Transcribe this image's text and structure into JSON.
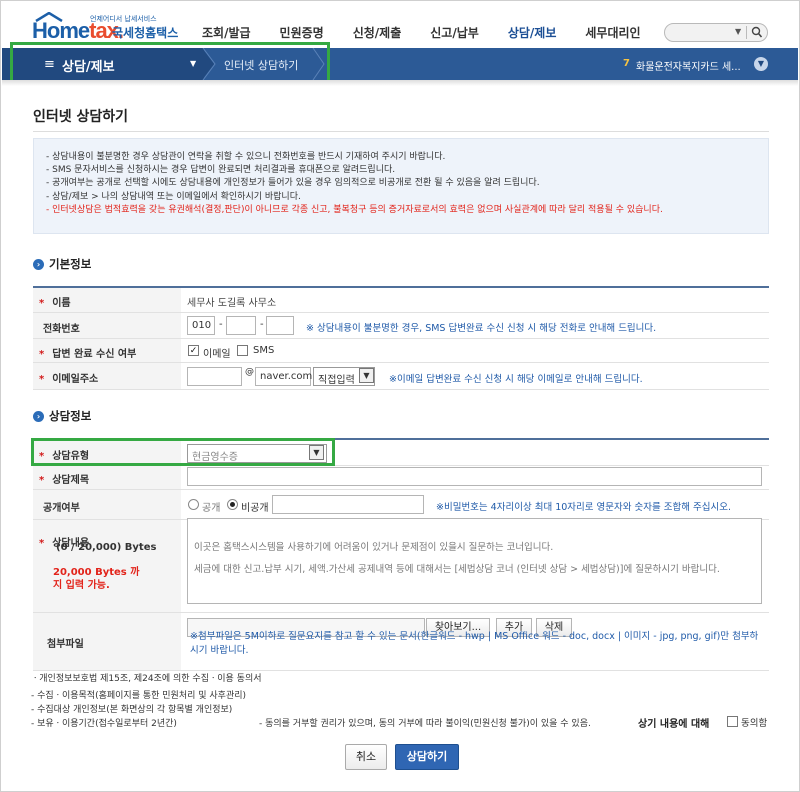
{
  "header": {
    "logo_text_home": "Home",
    "logo_text_tax": "tax.",
    "logo_tagline": "언제어디서 납세서비스",
    "logo_sub": "국세청홈택스",
    "menu": [
      "조회/발급",
      "민원증명",
      "신청/제출",
      "신고/납부",
      "상담/제보",
      "세무대리인"
    ],
    "active_menu": "상담/제보"
  },
  "navbar": {
    "crumb1": "상담/제보",
    "crumb2": "인터넷 상담하기",
    "notice_number": "7",
    "notice_text": "화물운전자복지카드 세..."
  },
  "page": {
    "title": "인터넷 상담하기",
    "info_lines": [
      "상담내용이 불분명한 경우 상담관이 연락을 취할 수 있으니 전화번호를 반드시 기재하여 주시기 바랍니다.",
      "SMS 문자서비스를 신청하시는 경우 답변이 완료되면 처리결과를 휴대폰으로 알려드립니다.",
      "공개여부는 공개로 선택할 시에도 상담내용에 개인정보가 들어가 있을 경우 임의적으로 비공개로 전환 될 수 있음을 알려 드립니다.",
      "상담/제보 > 나의 상담내역 또는 이메일에서 확인하시기 바랍니다.",
      "인터넷상담은 법적효력을 갖는 유권해석(결정,판단)이 아니므로 각종 신고, 불복청구 등의 증거자료로서의 효력은 없으며 사실관계에 따라 달리 적용될 수 있습니다."
    ]
  },
  "basic_info": {
    "section_title": "기본정보",
    "name_label": "이름",
    "name_value": "세무사 도길록 사무소",
    "phone_label": "전화번호",
    "phone_prefix": "010",
    "phone_dash": "-",
    "phone_hint": "※ 상담내용이 불분명한 경우, SMS 답변완료 수신 신청 시 해당 전화로 안내해 드립니다.",
    "reply_label": "답변 완료 수신 여부",
    "reply_email": "이메일",
    "reply_sms": "SMS",
    "email_label": "이메일주소",
    "email_at": "@",
    "email_domain": "naver.com",
    "email_select": "직접입력",
    "email_hint": "※이메일 답변완료 수신 신청 시 해당 이메일로 안내해 드립니다."
  },
  "consult_info": {
    "section_title": "상담정보",
    "type_label": "상담유형",
    "type_value": "현금영수증",
    "subject_label": "상담제목",
    "public_label": "공개여부",
    "public_option": "공개",
    "private_option": "비공개",
    "password_hint": "※비밀번호는 4자리이상 최대 10자리로 영문자와 숫자를 조합해 주십시오.",
    "content_label": "상담내용",
    "content_counter": "(0 / 20,000) Bytes",
    "content_limit": "20,000 Bytes 까지 입력 가능.",
    "content_placeholder_1": "이곳은 홈택스시스템을 사용하기에 어려움이 있거나 문제점이 있을시 질문하는 코너입니다.",
    "content_placeholder_2": "세금에 대한 신고.납부 시기, 세액.가산세 공제내역 등에 대해서는 [세법상담 코너 (인터넷 상담 > 세법상담)]에 질문하시기 바랍니다.",
    "attach_label": "첨부파일",
    "browse_button": "찾아보기...",
    "add_button": "추가",
    "delete_button": "삭제",
    "attach_note": "※첨부파일은 5M이하로 질문요지를 참고 할 수 있는 문서(한글워드 - hwp | MS Office 워드 - doc, docx | 이미지 - jpg, png, gif)만 첨부하시기 바랍니다."
  },
  "consent": {
    "title": "개인정보보호법 제15조, 제24조에 의한 수집ㆍ이용 동의서",
    "line1": "- 수집ㆍ이용목적(홈페이지를 통한 민원처리 및 사후관리)",
    "line2": "- 수집대상 개인정보(본 화면상의 각 항목별 개인정보)",
    "line3": "- 보유ㆍ이용기간(접수일로부터 2년간)",
    "right_text": "- 동의를 거부할 권리가 있으며, 동의 거부에 따라 불이익(민원신청 불가)이 있을 수 있음.",
    "agree_bold": "상기 내용에 대해",
    "agree_label": "동의함"
  },
  "buttons": {
    "cancel": "취소",
    "submit": "상담하기"
  },
  "colors": {
    "brand_blue": "#1c5fa8",
    "nav_blue": "#2c5a96",
    "highlight_green": "#35a943",
    "required_red": "#d21a1a",
    "hint_blue": "#1f5aa8"
  }
}
